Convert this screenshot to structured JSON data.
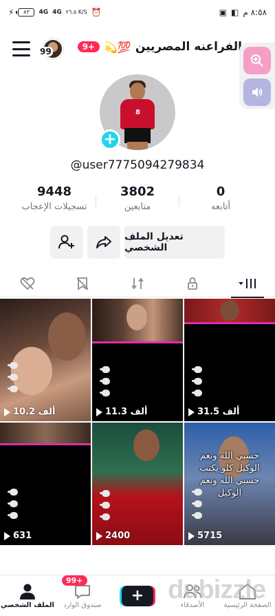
{
  "status_bar": {
    "time": "٨:٥٨ م",
    "battery": "٨٣",
    "network_1": "4G",
    "network_2": "4G",
    "speed": "٢٦.٥ K/S"
  },
  "header": {
    "title": "الفراعنه المصريين",
    "title_emoji": "💯💫",
    "notif_badge": "9+",
    "friends_count": "99"
  },
  "profile": {
    "username": "@user7775094279834",
    "avatar_jersey_number": "8",
    "stats": [
      {
        "value": "0",
        "label": "أتابعه"
      },
      {
        "value": "3802",
        "label": "متابعين"
      },
      {
        "value": "9448",
        "label": "تسجيلات الإعجاب"
      }
    ],
    "edit_profile_label": "تعديل الملف الشخصي"
  },
  "videos": [
    {
      "views": "10.2 ألف"
    },
    {
      "views": "11.3 ألف"
    },
    {
      "views": "31.5 ألف"
    },
    {
      "views": "631"
    },
    {
      "views": "2400"
    },
    {
      "views": "5715",
      "overlay": "حسبي الله ونعم الوكيل كلو يكتب حسبي الله ونعم الوكيل"
    }
  ],
  "bottom_nav": [
    {
      "label": "الصفحة الرئيسية",
      "icon": "home-icon"
    },
    {
      "label": "الأصدقاء",
      "icon": "friends-icon"
    },
    {
      "label": "",
      "icon": "plus-icon"
    },
    {
      "label": "صندوق الوارد",
      "icon": "inbox-icon",
      "badge": "99+"
    },
    {
      "label": "الملف الشخصي",
      "icon": "profile-icon"
    }
  ],
  "watermark": "dubizzle",
  "colors": {
    "accent_red": "#fe2c55",
    "accent_cyan": "#20d5ec",
    "text": "#161823"
  }
}
